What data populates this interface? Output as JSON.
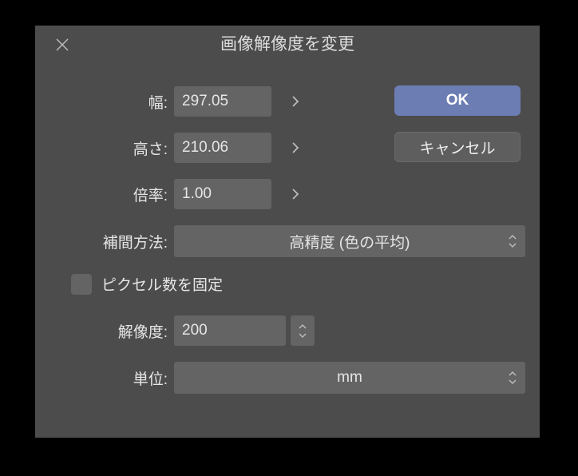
{
  "dialog": {
    "title": "画像解像度を変更"
  },
  "fields": {
    "width_label": "幅:",
    "width_value": "297.05",
    "height_label": "高さ:",
    "height_value": "210.06",
    "scale_label": "倍率:",
    "scale_value": "1.00",
    "interp_label": "補間方法:",
    "interp_value": "高精度 (色の平均)",
    "fix_pixels_label": "ピクセル数を固定",
    "resolution_label": "解像度:",
    "resolution_value": "200",
    "unit_label": "単位:",
    "unit_value": "mm"
  },
  "buttons": {
    "ok": "OK",
    "cancel": "キャンセル"
  }
}
